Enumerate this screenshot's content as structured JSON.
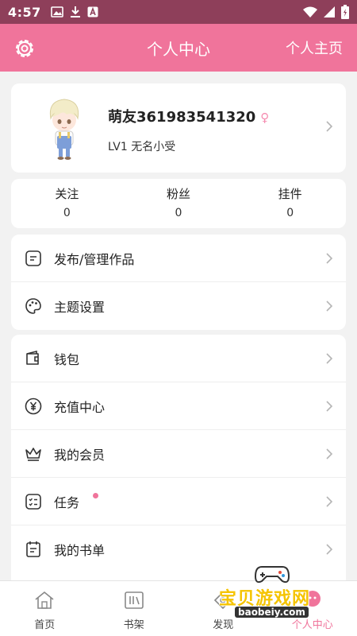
{
  "status_bar": {
    "time": "4:57"
  },
  "header": {
    "title": "个人中心",
    "homepage_label": "个人主页"
  },
  "profile": {
    "nickname": "萌友361983541320",
    "gender_symbol": "♀",
    "level": "LV1 无名小受"
  },
  "stats": [
    {
      "label": "关注",
      "count": "0"
    },
    {
      "label": "粉丝",
      "count": "0"
    },
    {
      "label": "挂件",
      "count": "0"
    }
  ],
  "menu_group_1": [
    {
      "label": "发布/管理作品",
      "icon": "edit-doc-icon"
    },
    {
      "label": "主题设置",
      "icon": "palette-icon"
    }
  ],
  "menu_group_2": [
    {
      "label": "钱包",
      "icon": "wallet-icon"
    },
    {
      "label": "充值中心",
      "icon": "yen-coin-icon"
    },
    {
      "label": "我的会员",
      "icon": "crown-icon"
    },
    {
      "label": "任务",
      "icon": "task-icon",
      "has_dot": true
    },
    {
      "label": "我的书单",
      "icon": "booklist-icon"
    }
  ],
  "bottom_nav": [
    {
      "label": "首页",
      "icon": "home-icon"
    },
    {
      "label": "书架",
      "icon": "bookshelf-icon"
    },
    {
      "label": "发现",
      "icon": "discover-icon"
    },
    {
      "label": "个人中心",
      "icon": "profile-icon",
      "active": true
    }
  ],
  "watermark": {
    "title": "宝贝游戏网",
    "url": "baobeiy.com"
  },
  "colors": {
    "accent": "#f0749b",
    "status_bar": "#8e3f5a",
    "background": "#f2f2f2"
  }
}
